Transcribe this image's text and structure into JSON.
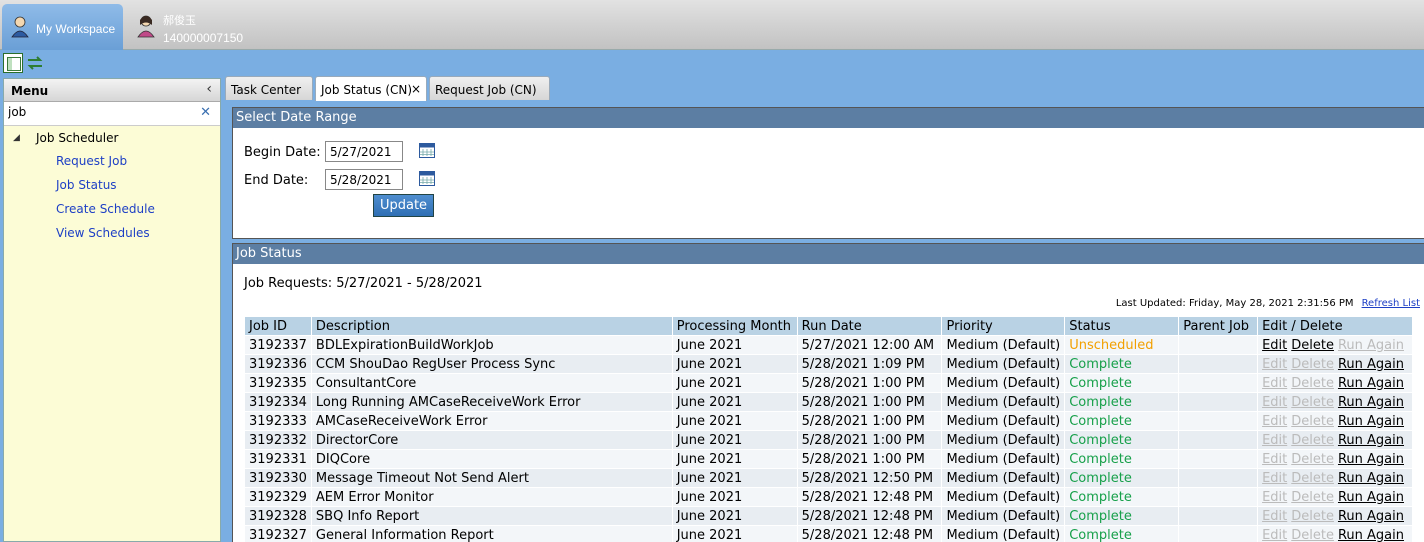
{
  "workspace": {
    "label": "My Workspace"
  },
  "user": {
    "name": "郝俊玉",
    "id": "140000007150"
  },
  "menu": {
    "title": "Menu",
    "search_value": "job",
    "root": "Job Scheduler",
    "items": [
      "Request Job",
      "Job Status",
      "Create Schedule",
      "View Schedules"
    ]
  },
  "tabs": [
    {
      "label": "Task Center"
    },
    {
      "label": "Job Status (CN)",
      "close": "×"
    },
    {
      "label": "Request Job (CN)"
    }
  ],
  "date_range": {
    "title": "Select Date Range",
    "begin_label": "Begin Date:",
    "begin_value": "5/27/2021",
    "end_label": "End Date:",
    "end_value": "5/28/2021",
    "update_label": "Update"
  },
  "job_status": {
    "title": "Job Status",
    "requests_label": "Job Requests: 5/27/2021 - 5/28/2021",
    "last_updated": "Last Updated: Friday, May 28, 2021 2:31:56 PM",
    "refresh_label": "Refresh List",
    "columns": [
      "Job ID",
      "Description",
      "Processing Month",
      "Run Date",
      "Priority",
      "Status",
      "Parent Job",
      "Edit / Delete"
    ],
    "actions": {
      "edit": "Edit",
      "delete": "Delete",
      "run_again": "Run Again"
    },
    "rows": [
      {
        "id": "3192337",
        "desc": "BDLExpirationBuildWorkJob",
        "month": "June 2021",
        "run": "5/27/2021 12:00 AM",
        "priority": "Medium (Default)",
        "status": "Unscheduled",
        "parent": ""
      },
      {
        "id": "3192336",
        "desc": "CCM ShouDao RegUser Process Sync",
        "month": "June 2021",
        "run": "5/28/2021 1:09 PM",
        "priority": "Medium (Default)",
        "status": "Complete",
        "parent": ""
      },
      {
        "id": "3192335",
        "desc": "ConsultantCore",
        "month": "June 2021",
        "run": "5/28/2021 1:00 PM",
        "priority": "Medium (Default)",
        "status": "Complete",
        "parent": ""
      },
      {
        "id": "3192334",
        "desc": "Long Running AMCaseReceiveWork Error",
        "month": "June 2021",
        "run": "5/28/2021 1:00 PM",
        "priority": "Medium (Default)",
        "status": "Complete",
        "parent": ""
      },
      {
        "id": "3192333",
        "desc": "AMCaseReceiveWork Error",
        "month": "June 2021",
        "run": "5/28/2021 1:00 PM",
        "priority": "Medium (Default)",
        "status": "Complete",
        "parent": ""
      },
      {
        "id": "3192332",
        "desc": "DirectorCore",
        "month": "June 2021",
        "run": "5/28/2021 1:00 PM",
        "priority": "Medium (Default)",
        "status": "Complete",
        "parent": ""
      },
      {
        "id": "3192331",
        "desc": "DIQCore",
        "month": "June 2021",
        "run": "5/28/2021 1:00 PM",
        "priority": "Medium (Default)",
        "status": "Complete",
        "parent": ""
      },
      {
        "id": "3192330",
        "desc": "Message Timeout Not Send Alert",
        "month": "June 2021",
        "run": "5/28/2021 12:50 PM",
        "priority": "Medium (Default)",
        "status": "Complete",
        "parent": ""
      },
      {
        "id": "3192329",
        "desc": "AEM Error Monitor",
        "month": "June 2021",
        "run": "5/28/2021 12:48 PM",
        "priority": "Medium (Default)",
        "status": "Complete",
        "parent": ""
      },
      {
        "id": "3192328",
        "desc": "SBQ Info Report",
        "month": "June 2021",
        "run": "5/28/2021 12:48 PM",
        "priority": "Medium (Default)",
        "status": "Complete",
        "parent": ""
      },
      {
        "id": "3192327",
        "desc": "General Information Report",
        "month": "June 2021",
        "run": "5/28/2021 12:48 PM",
        "priority": "Medium (Default)",
        "status": "Complete",
        "parent": ""
      }
    ]
  }
}
